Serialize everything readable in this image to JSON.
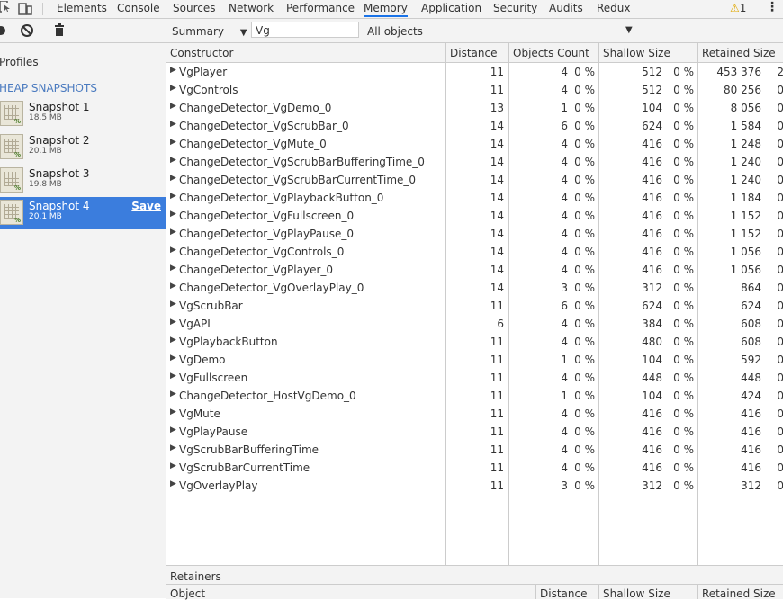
{
  "tabs": [
    {
      "label": "Elements"
    },
    {
      "label": "Console"
    },
    {
      "label": "Sources"
    },
    {
      "label": "Network"
    },
    {
      "label": "Performance"
    },
    {
      "label": "Memory"
    },
    {
      "label": "Application"
    },
    {
      "label": "Security"
    },
    {
      "label": "Audits"
    },
    {
      "label": "Redux"
    }
  ],
  "warning_count": "1",
  "toolbar": {
    "view_select": "Summary",
    "filter_value": "Vg",
    "objects_select": "All objects"
  },
  "sidebar": {
    "profiles_label": "Profiles",
    "section_label": "HEAP SNAPSHOTS",
    "snapshots": [
      {
        "name": "Snapshot 1",
        "size": "18.5 MB"
      },
      {
        "name": "Snapshot 2",
        "size": "20.1 MB"
      },
      {
        "name": "Snapshot 3",
        "size": "19.8 MB"
      },
      {
        "name": "Snapshot 4",
        "size": "20.1 MB"
      }
    ],
    "save_label": "Save"
  },
  "columns": {
    "constructor": "Constructor",
    "distance": "Distance",
    "objects_count": "Objects Count",
    "shallow_size": "Shallow Size",
    "retained_size": "Retained Size"
  },
  "rows": [
    {
      "name": "VgPlayer",
      "distance": "11",
      "count": "4",
      "count_pct": "0 %",
      "shallow": "512",
      "shallow_pct": "0 %",
      "retained": "453 376",
      "retained_pct": "2"
    },
    {
      "name": "VgControls",
      "distance": "11",
      "count": "4",
      "count_pct": "0 %",
      "shallow": "512",
      "shallow_pct": "0 %",
      "retained": "80 256",
      "retained_pct": "0"
    },
    {
      "name": "ChangeDetector_VgDemo_0",
      "distance": "13",
      "count": "1",
      "count_pct": "0 %",
      "shallow": "104",
      "shallow_pct": "0 %",
      "retained": "8 056",
      "retained_pct": "0"
    },
    {
      "name": "ChangeDetector_VgScrubBar_0",
      "distance": "14",
      "count": "6",
      "count_pct": "0 %",
      "shallow": "624",
      "shallow_pct": "0 %",
      "retained": "1 584",
      "retained_pct": "0"
    },
    {
      "name": "ChangeDetector_VgMute_0",
      "distance": "14",
      "count": "4",
      "count_pct": "0 %",
      "shallow": "416",
      "shallow_pct": "0 %",
      "retained": "1 248",
      "retained_pct": "0"
    },
    {
      "name": "ChangeDetector_VgScrubBarBufferingTime_0",
      "distance": "14",
      "count": "4",
      "count_pct": "0 %",
      "shallow": "416",
      "shallow_pct": "0 %",
      "retained": "1 240",
      "retained_pct": "0"
    },
    {
      "name": "ChangeDetector_VgScrubBarCurrentTime_0",
      "distance": "14",
      "count": "4",
      "count_pct": "0 %",
      "shallow": "416",
      "shallow_pct": "0 %",
      "retained": "1 240",
      "retained_pct": "0"
    },
    {
      "name": "ChangeDetector_VgPlaybackButton_0",
      "distance": "14",
      "count": "4",
      "count_pct": "0 %",
      "shallow": "416",
      "shallow_pct": "0 %",
      "retained": "1 184",
      "retained_pct": "0"
    },
    {
      "name": "ChangeDetector_VgFullscreen_0",
      "distance": "14",
      "count": "4",
      "count_pct": "0 %",
      "shallow": "416",
      "shallow_pct": "0 %",
      "retained": "1 152",
      "retained_pct": "0"
    },
    {
      "name": "ChangeDetector_VgPlayPause_0",
      "distance": "14",
      "count": "4",
      "count_pct": "0 %",
      "shallow": "416",
      "shallow_pct": "0 %",
      "retained": "1 152",
      "retained_pct": "0"
    },
    {
      "name": "ChangeDetector_VgControls_0",
      "distance": "14",
      "count": "4",
      "count_pct": "0 %",
      "shallow": "416",
      "shallow_pct": "0 %",
      "retained": "1 056",
      "retained_pct": "0"
    },
    {
      "name": "ChangeDetector_VgPlayer_0",
      "distance": "14",
      "count": "4",
      "count_pct": "0 %",
      "shallow": "416",
      "shallow_pct": "0 %",
      "retained": "1 056",
      "retained_pct": "0"
    },
    {
      "name": "ChangeDetector_VgOverlayPlay_0",
      "distance": "14",
      "count": "3",
      "count_pct": "0 %",
      "shallow": "312",
      "shallow_pct": "0 %",
      "retained": "864",
      "retained_pct": "0"
    },
    {
      "name": "VgScrubBar",
      "distance": "11",
      "count": "6",
      "count_pct": "0 %",
      "shallow": "624",
      "shallow_pct": "0 %",
      "retained": "624",
      "retained_pct": "0"
    },
    {
      "name": "VgAPI",
      "distance": "6",
      "count": "4",
      "count_pct": "0 %",
      "shallow": "384",
      "shallow_pct": "0 %",
      "retained": "608",
      "retained_pct": "0"
    },
    {
      "name": "VgPlaybackButton",
      "distance": "11",
      "count": "4",
      "count_pct": "0 %",
      "shallow": "480",
      "shallow_pct": "0 %",
      "retained": "608",
      "retained_pct": "0"
    },
    {
      "name": "VgDemo",
      "distance": "11",
      "count": "1",
      "count_pct": "0 %",
      "shallow": "104",
      "shallow_pct": "0 %",
      "retained": "592",
      "retained_pct": "0"
    },
    {
      "name": "VgFullscreen",
      "distance": "11",
      "count": "4",
      "count_pct": "0 %",
      "shallow": "448",
      "shallow_pct": "0 %",
      "retained": "448",
      "retained_pct": "0"
    },
    {
      "name": "ChangeDetector_HostVgDemo_0",
      "distance": "11",
      "count": "1",
      "count_pct": "0 %",
      "shallow": "104",
      "shallow_pct": "0 %",
      "retained": "424",
      "retained_pct": "0"
    },
    {
      "name": "VgMute",
      "distance": "11",
      "count": "4",
      "count_pct": "0 %",
      "shallow": "416",
      "shallow_pct": "0 %",
      "retained": "416",
      "retained_pct": "0"
    },
    {
      "name": "VgPlayPause",
      "distance": "11",
      "count": "4",
      "count_pct": "0 %",
      "shallow": "416",
      "shallow_pct": "0 %",
      "retained": "416",
      "retained_pct": "0"
    },
    {
      "name": "VgScrubBarBufferingTime",
      "distance": "11",
      "count": "4",
      "count_pct": "0 %",
      "shallow": "416",
      "shallow_pct": "0 %",
      "retained": "416",
      "retained_pct": "0"
    },
    {
      "name": "VgScrubBarCurrentTime",
      "distance": "11",
      "count": "4",
      "count_pct": "0 %",
      "shallow": "416",
      "shallow_pct": "0 %",
      "retained": "416",
      "retained_pct": "0"
    },
    {
      "name": "VgOverlayPlay",
      "distance": "11",
      "count": "3",
      "count_pct": "0 %",
      "shallow": "312",
      "shallow_pct": "0 %",
      "retained": "312",
      "retained_pct": "0"
    }
  ],
  "retainers": {
    "title": "Retainers",
    "columns": {
      "object": "Object",
      "distance": "Distance",
      "shallow_size": "Shallow Size",
      "retained_size": "Retained Size"
    }
  }
}
